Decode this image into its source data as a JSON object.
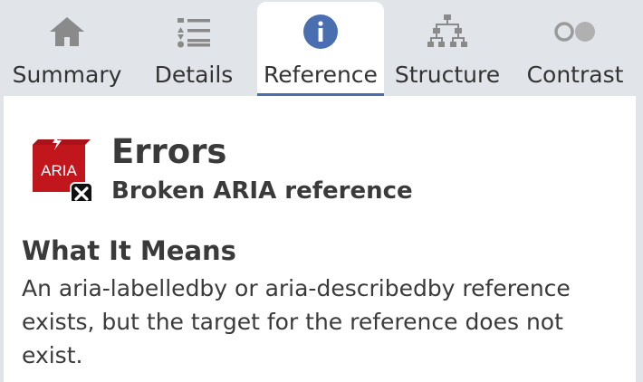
{
  "tabs": [
    {
      "label": "Summary",
      "icon": "home-icon"
    },
    {
      "label": "Details",
      "icon": "list-icon"
    },
    {
      "label": "Reference",
      "icon": "info-icon",
      "active": true
    },
    {
      "label": "Structure",
      "icon": "hierarchy-icon"
    },
    {
      "label": "Contrast",
      "icon": "contrast-icon"
    }
  ],
  "badge": {
    "text": "ARIA",
    "icon": "aria-error-icon"
  },
  "error": {
    "title": "Errors",
    "subtitle": "Broken ARIA reference"
  },
  "section": {
    "heading": "What It Means",
    "body": "An aria-labelledby or aria-describedby reference exists, but the target for the reference does not exist."
  },
  "colors": {
    "accent": "#4a6fb0",
    "error_red": "#c0161c",
    "tab_bg": "#e1e4e8",
    "icon_gray": "#8a8a8a"
  }
}
